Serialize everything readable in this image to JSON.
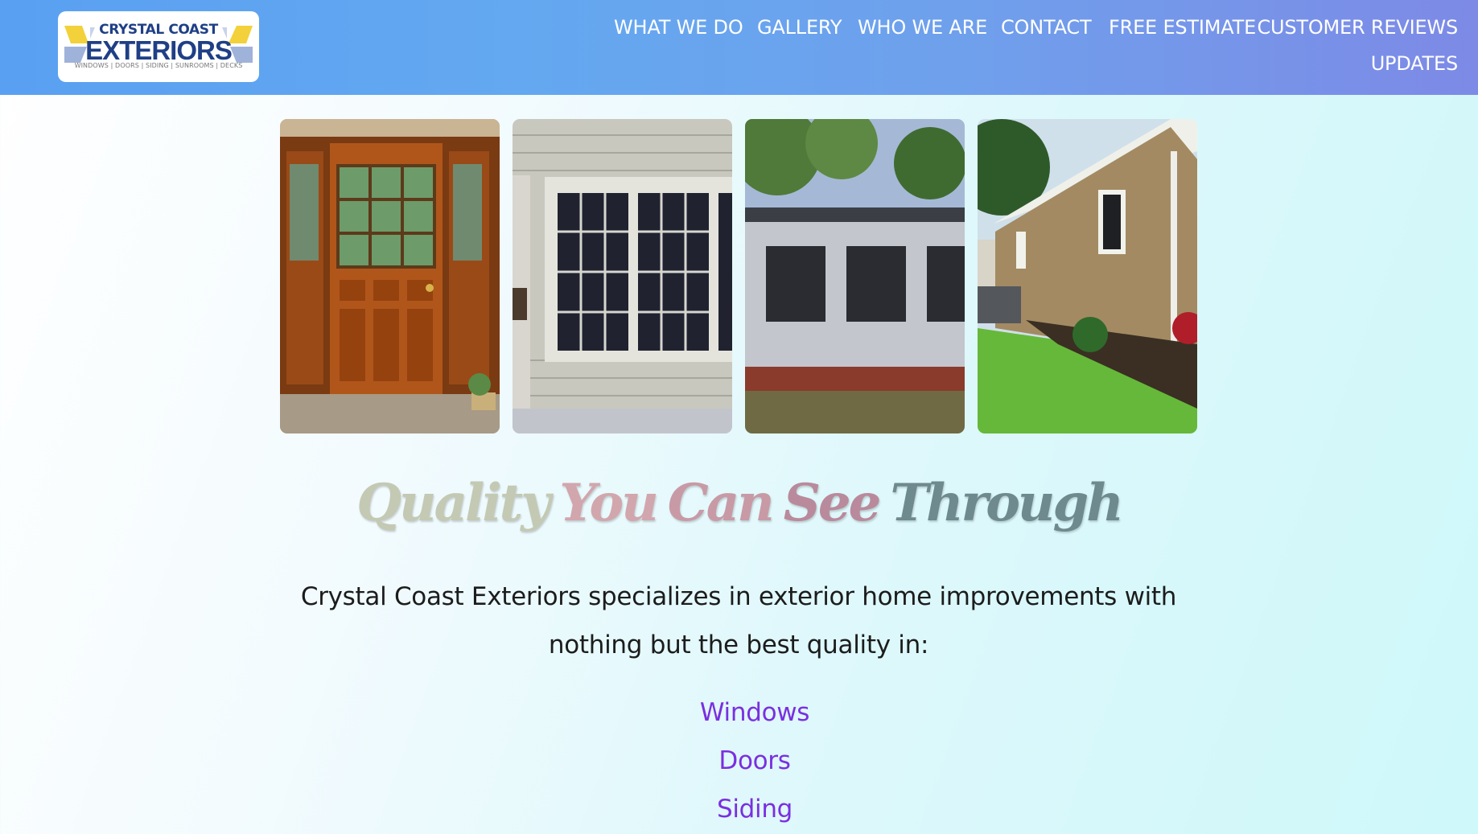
{
  "logo": {
    "line1": "CRYSTAL COAST",
    "line2": "EXTERIORS",
    "tagline": "WINDOWS | DOORS | SIDING | SUNROOMS | DECKS"
  },
  "nav": {
    "items": [
      {
        "label": "WHAT WE DO"
      },
      {
        "label": "GALLERY"
      },
      {
        "label": "WHO WE ARE"
      },
      {
        "label": "CONTACT"
      },
      {
        "label": "FREE ESTIMATE"
      },
      {
        "label": "CUSTOMER REVIEWS"
      },
      {
        "label": "UPDATES"
      }
    ]
  },
  "headline": {
    "words": [
      "Quality",
      "You",
      "Can",
      "See",
      "Through"
    ],
    "colors": [
      "#c3c9b3",
      "#d2a6ad",
      "#c89aa6",
      "#b98a9c",
      "#6f8a8e"
    ]
  },
  "intro": {
    "text": "Crystal Coast Exteriors specializes in exterior home improvements with nothing but the best quality in:"
  },
  "services": {
    "items": [
      {
        "label": "Windows"
      },
      {
        "label": "Doors"
      },
      {
        "label": "Siding"
      }
    ]
  },
  "colors": {
    "header_gradient_start": "#5aa0f2",
    "header_gradient_end": "#7d8ae6",
    "link": "#7a2fe0",
    "logo_navy": "#1f3f86",
    "logo_yellow": "#f2d13a"
  }
}
